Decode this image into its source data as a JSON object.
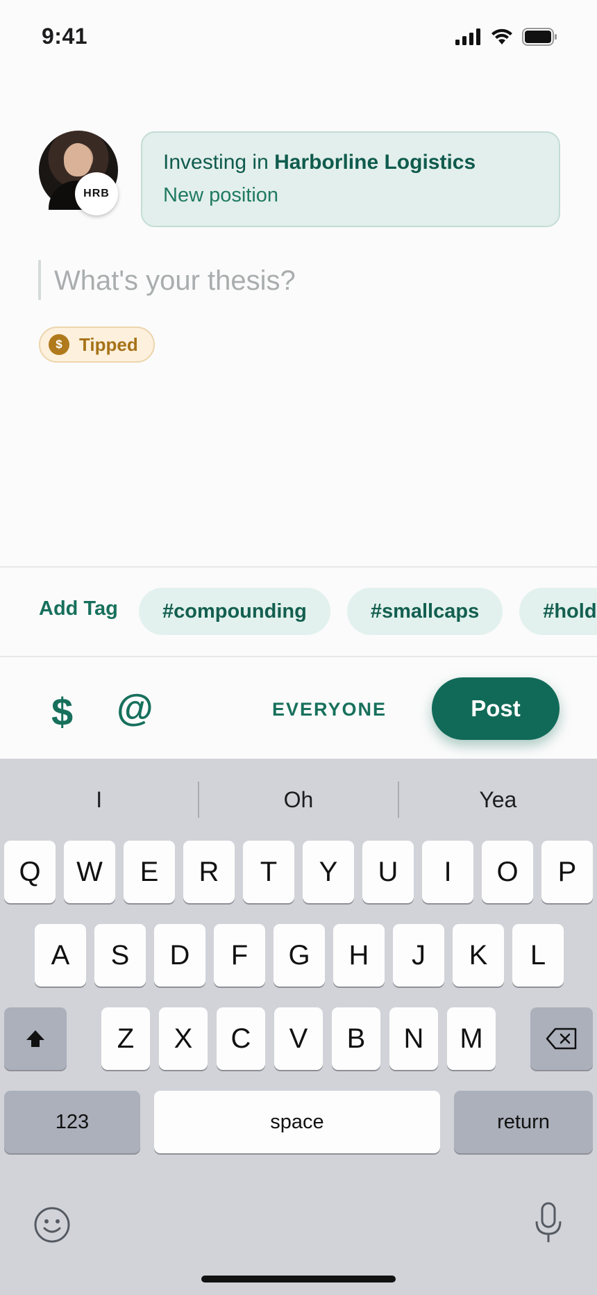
{
  "status_bar": {
    "time": "9:41"
  },
  "composer": {
    "avatar_badge": "HRB",
    "position_prefix": "Investing in",
    "company": "Harborline Logistics",
    "position_type": "New position",
    "thesis_placeholder": "What's your thesis?",
    "tipped_label": "Tipped",
    "coin_symbol": "$"
  },
  "tags": {
    "add_label": "Add Tag",
    "items": [
      "#compounding",
      "#smallcaps",
      "#hold"
    ]
  },
  "actions": {
    "dollar": "$",
    "mention": "@",
    "audience": "EVERYONE",
    "post": "Post"
  },
  "keyboard": {
    "suggestions": [
      "I",
      "Oh",
      "Yea"
    ],
    "row1": [
      "Q",
      "W",
      "E",
      "R",
      "T",
      "Y",
      "U",
      "I",
      "O",
      "P"
    ],
    "row2": [
      "A",
      "S",
      "D",
      "F",
      "G",
      "H",
      "J",
      "K",
      "L"
    ],
    "row3": [
      "Z",
      "X",
      "C",
      "V",
      "B",
      "N",
      "M"
    ],
    "numbers": "123",
    "space": "space",
    "return": "return"
  },
  "colors": {
    "accent": "#116a57",
    "tipped": "#a67218",
    "tag_bg": "#e2f1ed"
  }
}
